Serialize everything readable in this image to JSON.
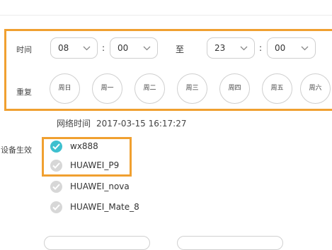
{
  "schedule": {
    "time_label": "时间",
    "start_hour": "08",
    "start_minute": "00",
    "to_label": "至",
    "end_hour": "23",
    "end_minute": "00",
    "colon": ":",
    "repeat_label": "重复",
    "days": [
      "周日",
      "周一",
      "周二",
      "周三",
      "周四",
      "周五",
      "周六"
    ]
  },
  "network_time": {
    "label": "网络时间",
    "value": "2017-03-15 16:17:27"
  },
  "devices": {
    "label": "设备生效",
    "items": [
      {
        "name": "wx888",
        "checked": true
      },
      {
        "name": "HUAWEI_P9",
        "checked": false
      },
      {
        "name": "HUAWEI_nova",
        "checked": false
      },
      {
        "name": "HUAWEI_Mate_8",
        "checked": false
      }
    ]
  },
  "colors": {
    "highlight": "#f0a030",
    "checked": "#3ec0cf",
    "unchecked": "#d7d7d7"
  }
}
